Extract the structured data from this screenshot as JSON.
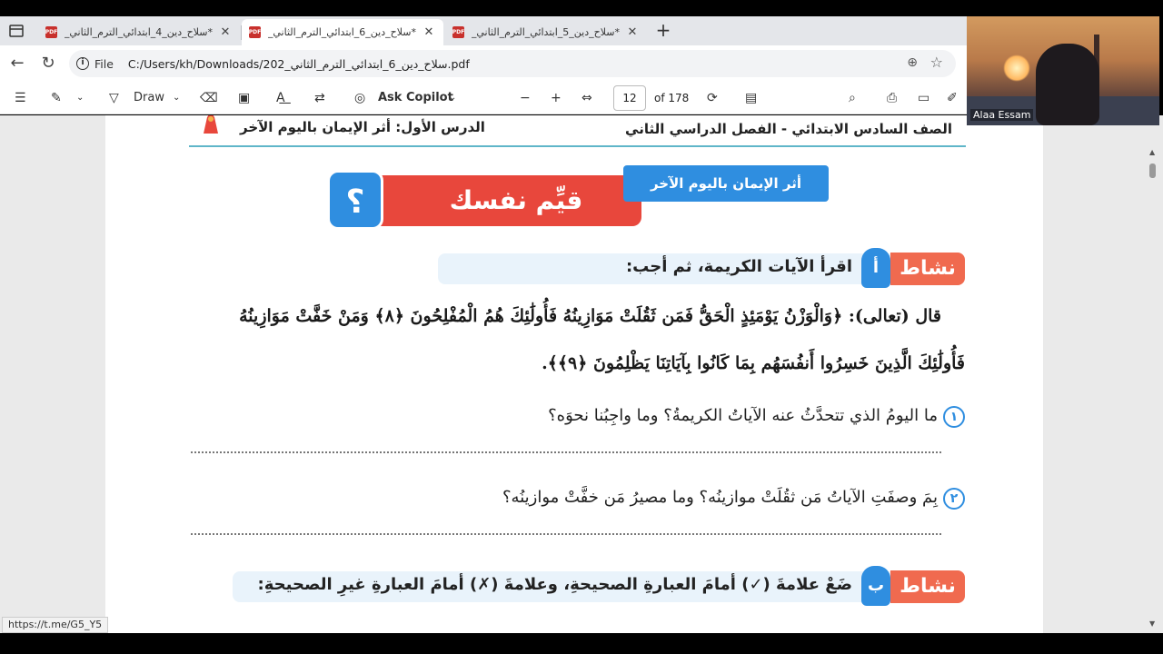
{
  "browser": {
    "tabs": [
      {
        "title": "*سلاح_دين_4_ابتدائي_الترم_الثاني_6",
        "active": false
      },
      {
        "title": "*سلاح_دين_6_ابتدائي_الترم_الثاني_2",
        "active": true
      },
      {
        "title": "*سلاح_دين_5_ابتدائي_الترم_الثاني_6",
        "active": false
      }
    ],
    "address": {
      "scheme_label": "File",
      "path": "C:/Users/kh/Downloads/202_سلاح_دين_6_ابتدائي_الترم_الثاني.pdf"
    }
  },
  "pdf_toolbar": {
    "draw_label": "Draw",
    "copilot_label": "Ask Copilot",
    "current_page": "12",
    "page_count_label": "of 178"
  },
  "page": {
    "header": {
      "grade": "الصف السادس الابتدائي - الفصل الدراسي الثاني",
      "lesson": "الدرس الأول: أثر الإيمان باليوم الآخر"
    },
    "eval_banner": {
      "topic": "أثر الإيمان باليوم الآخر",
      "title": "قيِّم نفسك",
      "icon_char": "؟"
    },
    "activity_a": {
      "label": "نشاط",
      "letter": "أ",
      "instruction": "اقرأ الآيات الكريمة، ثم أجب:"
    },
    "verse_line1": "قال (تعالى): ﴿وَالْوَزْنُ يَوْمَئِذٍ الْحَقُّ فَمَن ثَقُلَتْ مَوَازِينُهُ فَأُولَٰئِكَ هُمُ الْمُفْلِحُونَ ﴿٨﴾ وَمَنْ خَفَّتْ مَوَازِينُهُ",
    "verse_line2": "فَأُولَٰئِكَ الَّذِينَ خَسِرُوا أَنفُسَهُم بِمَا كَانُوا بِآيَاتِنَا يَظْلِمُونَ ﴿٩﴾﴾.",
    "questions": [
      {
        "num": "١",
        "text": "ما اليومُ الذي تتحدَّثُ عنه الآياتُ الكريمةُ؟ وما واجِبُنا نحوَه؟"
      },
      {
        "num": "٢",
        "text": "بِمَ وصفَتِ الآياتُ مَن ثقُلَتْ موازينُه؟ وما مصيرُ مَن خفَّتْ موازينُه؟"
      }
    ],
    "activity_b": {
      "label": "نشاط",
      "letter": "ب",
      "instruction": "ضَعْ علامةَ (✓) أمامَ العبارةِ الصحيحةِ، وعلامةَ (✗) أمامَ العبارةِ غيرِ الصحيحةِ:"
    }
  },
  "status_url": "https://t.me/G5_Y5",
  "webcam": {
    "participant_name": "Alaa Essam"
  }
}
